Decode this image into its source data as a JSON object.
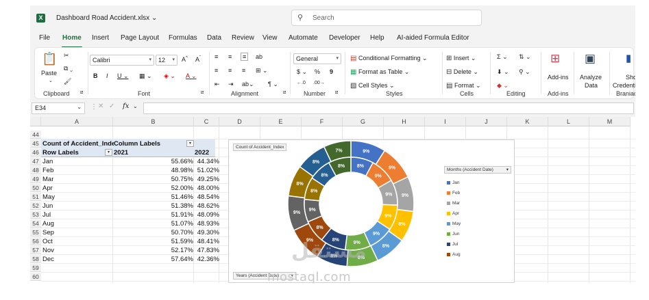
{
  "app": {
    "file_title": "Dashboard Road Accident.xlsx",
    "search_placeholder": "Search"
  },
  "menu": {
    "tabs": [
      "File",
      "Home",
      "Insert",
      "Page Layout",
      "Formulas",
      "Data",
      "Review",
      "View",
      "Automate",
      "Developer",
      "Help",
      "AI-aided Formula Editor"
    ],
    "active": "Home"
  },
  "ribbon": {
    "clipboard": {
      "paste": "Paste",
      "label": "Clipboard"
    },
    "font": {
      "name": "Calibri",
      "size": "12",
      "label": "Font",
      "inc": "A^",
      "dec": "A˅"
    },
    "alignment": {
      "label": "Alignment"
    },
    "number": {
      "format": "General",
      "label": "Number",
      "currency": "$",
      "percent": "%",
      "comma": "9"
    },
    "styles": {
      "cond": "Conditional Formatting",
      "table": "Format as Table",
      "cell": "Cell Styles",
      "label": "Styles"
    },
    "cells": {
      "insert": "Insert",
      "delete": "Delete",
      "format": "Format",
      "label": "Cells"
    },
    "editing": {
      "label": "Editing"
    },
    "addins": {
      "btn": "Add-ins",
      "label": "Add-ins"
    },
    "analyze": {
      "btn1": "Analyze",
      "btn2": "Data"
    },
    "show": {
      "btn1": "Sho",
      "btn2": "Credenti",
      "label": "Braniac"
    }
  },
  "formula_bar": {
    "name_box": "E34",
    "fx": "fx"
  },
  "grid": {
    "columns": [
      "A",
      "B",
      "C",
      "D",
      "E",
      "F",
      "G",
      "H",
      "I",
      "J",
      "K",
      "L",
      "M"
    ],
    "rows": [
      "44",
      "45",
      "46",
      "47",
      "48",
      "49",
      "50",
      "51",
      "52",
      "53",
      "54",
      "55",
      "56",
      "57",
      "58",
      "59",
      "60"
    ],
    "pivot": {
      "title_a": "Count of Accident_Inde",
      "title_b": "Column Labels",
      "row_labels": "Row Labels",
      "year1": "2021",
      "year2": "2022",
      "data": [
        {
          "m": "Jan",
          "a": "55.66%",
          "b": "44.34%"
        },
        {
          "m": "Feb",
          "a": "48.98%",
          "b": "51.02%"
        },
        {
          "m": "Mar",
          "a": "50.75%",
          "b": "49.25%"
        },
        {
          "m": "Apr",
          "a": "52.00%",
          "b": "48.00%"
        },
        {
          "m": "May",
          "a": "51.46%",
          "b": "48.54%"
        },
        {
          "m": "Jun",
          "a": "51.38%",
          "b": "48.62%"
        },
        {
          "m": "Jul",
          "a": "51.91%",
          "b": "48.09%"
        },
        {
          "m": "Aug",
          "a": "51.07%",
          "b": "48.93%"
        },
        {
          "m": "Sep",
          "a": "50.70%",
          "b": "49.30%"
        },
        {
          "m": "Oct",
          "a": "51.59%",
          "b": "48.41%"
        },
        {
          "m": "Nov",
          "a": "52.17%",
          "b": "47.83%"
        },
        {
          "m": "Dec",
          "a": "57.64%",
          "b": "42.36%"
        }
      ]
    }
  },
  "chart_data": {
    "type": "pie",
    "variant": "doughnut",
    "field_value": "Count of Accident_Index",
    "field_axis": "Years (Accident Date)",
    "legend_title": "Months (Accident Date)",
    "legend": [
      "Jan",
      "Feb",
      "Mar",
      "Apr",
      "May",
      "Jun",
      "Jul",
      "Aug"
    ],
    "categories": [
      "Jan",
      "Feb",
      "Mar",
      "Apr",
      "May",
      "Jun",
      "Jul",
      "Aug",
      "Sep",
      "Oct",
      "Nov",
      "Dec"
    ],
    "colors": [
      "#4472c4",
      "#ed7d31",
      "#a5a5a5",
      "#ffc000",
      "#5b9bd5",
      "#70ad47",
      "#264478",
      "#9e480e",
      "#636363",
      "#997300",
      "#255e91",
      "#43682b"
    ],
    "series": [
      {
        "values": [
          9,
          9,
          9,
          8,
          8,
          8,
          8,
          9,
          9,
          8,
          8,
          7
        ],
        "labels": [
          "9%",
          "9%",
          "9%",
          "8%",
          "8%",
          "8%",
          "8%",
          "9%",
          "9%",
          "8%",
          "8%",
          "7%"
        ]
      },
      {
        "values": [
          8,
          9,
          9,
          9,
          9,
          9,
          9,
          8,
          8,
          8,
          8,
          8
        ],
        "labels": [
          "8%",
          "9%",
          "9%",
          "9%",
          "9%",
          "9%",
          "8%",
          "8%",
          "9%",
          "8%",
          "8%",
          "8%"
        ]
      }
    ]
  },
  "watermark": {
    "text": "mostaql.com",
    "big": "مستقل"
  }
}
